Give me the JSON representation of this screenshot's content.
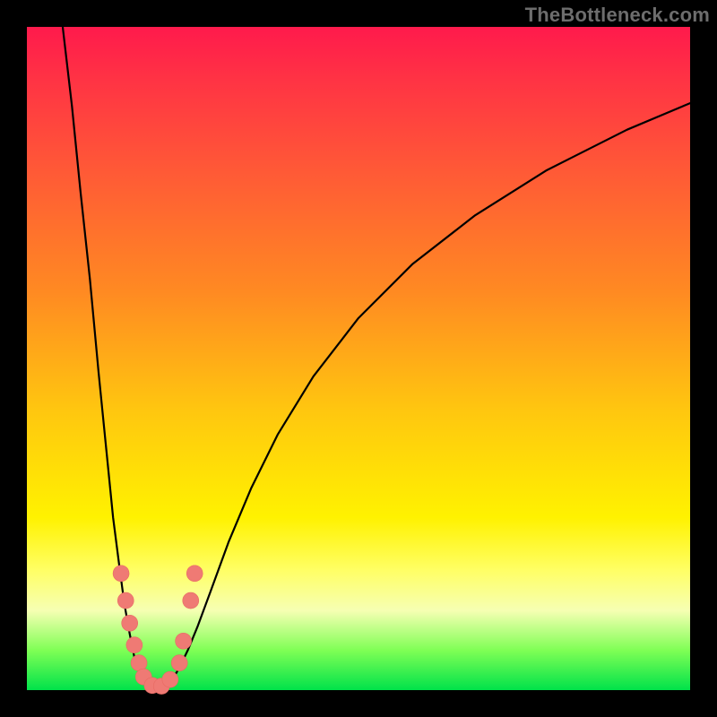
{
  "watermark": {
    "text": "TheBottleneck.com"
  },
  "chart_data": {
    "type": "line",
    "title": "",
    "xlabel": "",
    "ylabel": "",
    "xlim": [
      0,
      100
    ],
    "ylim": [
      0,
      100
    ],
    "series": [
      {
        "name": "left-branch",
        "x": [
          5.4,
          6.8,
          8.1,
          9.5,
          10.8,
          12.2,
          13.0,
          13.9,
          14.7,
          15.5,
          16.2,
          16.9,
          17.6
        ],
        "y": [
          100,
          88,
          75,
          62,
          48,
          34,
          26,
          19,
          13,
          8.5,
          5,
          2.7,
          1.4
        ]
      },
      {
        "name": "valley",
        "x": [
          17.6,
          18.2,
          18.9,
          19.6,
          20.3,
          20.9,
          21.6,
          22.3,
          23.0
        ],
        "y": [
          1.4,
          0.8,
          0.5,
          0.5,
          0.6,
          0.9,
          1.4,
          2.2,
          3.4
        ]
      },
      {
        "name": "right-branch",
        "x": [
          23.0,
          24.3,
          25.7,
          27.7,
          30.4,
          33.8,
          37.8,
          43.2,
          50.0,
          58.1,
          67.6,
          78.4,
          90.5,
          100.0
        ],
        "y": [
          3.4,
          6.1,
          9.5,
          14.9,
          22.3,
          30.4,
          38.5,
          47.3,
          56.1,
          64.2,
          71.6,
          78.4,
          84.5,
          88.5
        ]
      }
    ],
    "markers": {
      "name": "highlight-dots",
      "points": [
        {
          "x": 14.2,
          "y": 17.6
        },
        {
          "x": 14.9,
          "y": 13.5
        },
        {
          "x": 15.5,
          "y": 10.1
        },
        {
          "x": 16.2,
          "y": 6.8
        },
        {
          "x": 16.9,
          "y": 4.1
        },
        {
          "x": 17.6,
          "y": 2.0
        },
        {
          "x": 18.9,
          "y": 0.7
        },
        {
          "x": 20.3,
          "y": 0.6
        },
        {
          "x": 21.6,
          "y": 1.6
        },
        {
          "x": 23.0,
          "y": 4.1
        },
        {
          "x": 23.6,
          "y": 7.4
        },
        {
          "x": 24.7,
          "y": 13.5
        },
        {
          "x": 25.3,
          "y": 17.6
        }
      ]
    }
  }
}
